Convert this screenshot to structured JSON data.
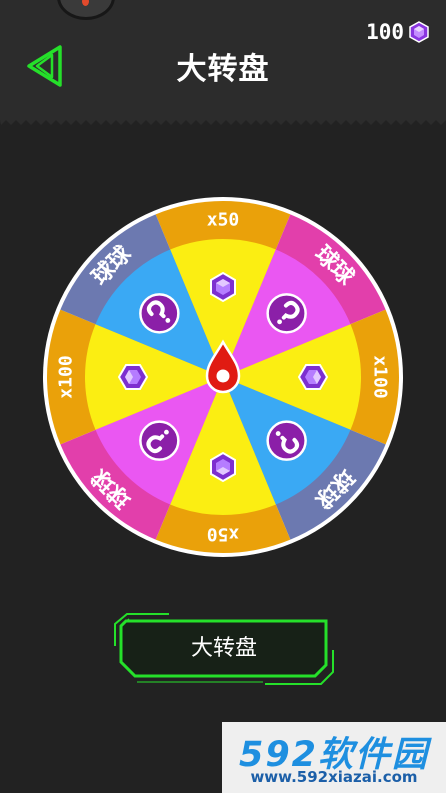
{
  "header": {
    "title": "大转盘",
    "gems_count": "100"
  },
  "wheel": {
    "outer_labels": [
      "x50",
      "球球",
      "x100",
      "球球",
      "x50",
      "球球",
      "x100",
      "球球"
    ],
    "inner_items": [
      "gem",
      "mystery",
      "gem",
      "mystery",
      "gem",
      "mystery",
      "gem",
      "mystery"
    ],
    "outer_colors": [
      "#eaa10a",
      "#e23fab",
      "#eaa10a",
      "#6c79b0",
      "#eaa10a",
      "#e23fab",
      "#eaa10a",
      "#6c79b0"
    ],
    "inner_colors": [
      "#fbee12",
      "#ea57f2",
      "#fbee12",
      "#3aa9f4",
      "#fbee12",
      "#ea57f2",
      "#fbee12",
      "#3aa9f4"
    ]
  },
  "spin_button": {
    "label": "大转盘"
  },
  "watermark": {
    "brand": "592软件园",
    "url": "www.592xiazai.com"
  },
  "colors": {
    "accent_green": "#25e02a",
    "background": "#222222",
    "header": "#2c2c2c",
    "gem_purple": "#9b3ff0"
  }
}
